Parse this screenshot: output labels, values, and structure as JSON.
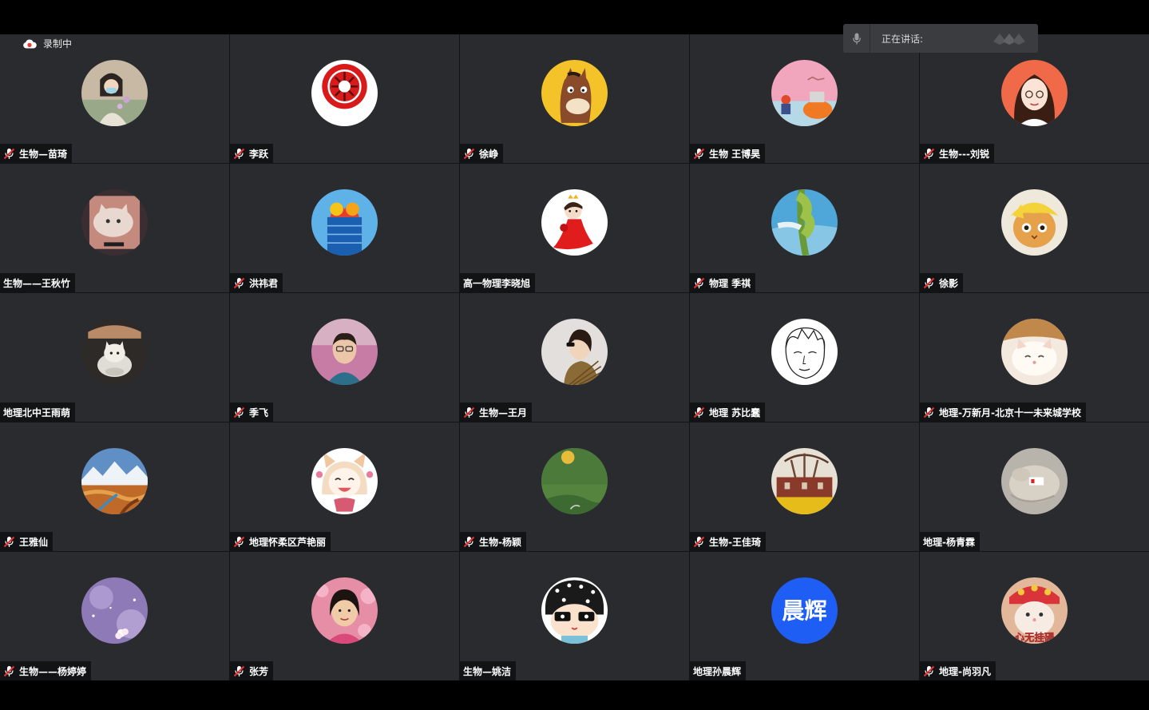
{
  "recording": {
    "label": "录制中",
    "icon": "cloud-record-icon",
    "color": "#e53935"
  },
  "speaking": {
    "label": "正在讲话:",
    "icon": "microphone-icon"
  },
  "participants": [
    {
      "name": "生物—苗琦",
      "muted": true,
      "avatar": "photo-girl-mask"
    },
    {
      "name": "李跃",
      "muted": true,
      "avatar": "red-emblem"
    },
    {
      "name": "徐峥",
      "muted": true,
      "avatar": "cartoon-horse"
    },
    {
      "name": "生物 王博昊",
      "muted": true,
      "avatar": "pink-landscape"
    },
    {
      "name": "生物---刘锐",
      "muted": true,
      "avatar": "illustrated-girl"
    },
    {
      "name": "生物——王秋竹",
      "muted": false,
      "avatar": "cat-photo"
    },
    {
      "name": "洪祎君",
      "muted": true,
      "avatar": "blue-building"
    },
    {
      "name": "高一物理李晓旭",
      "muted": false,
      "avatar": "cartoon-caped-boy"
    },
    {
      "name": "物理 季祺",
      "muted": true,
      "avatar": "green-plant"
    },
    {
      "name": "徐影",
      "muted": true,
      "avatar": "cat-in-hat"
    },
    {
      "name": "地理北中王雨萌",
      "muted": false,
      "avatar": "cat-in-cup"
    },
    {
      "name": "季飞",
      "muted": true,
      "avatar": "man-flowers"
    },
    {
      "name": "生物—王月",
      "muted": true,
      "avatar": "woman-sunglasses"
    },
    {
      "name": "地理 苏比蠢",
      "muted": true,
      "avatar": "sketch-face"
    },
    {
      "name": "地理-万新月-北京十一未来城学校",
      "muted": true,
      "avatar": "sleeping-cat"
    },
    {
      "name": "王雅仙",
      "muted": true,
      "avatar": "autumn-valley"
    },
    {
      "name": "地理怀柔区芦艳丽",
      "muted": true,
      "avatar": "anime-fox-girl"
    },
    {
      "name": "生物-杨颖",
      "muted": true,
      "avatar": "green-moon"
    },
    {
      "name": "生物-王佳琦",
      "muted": true,
      "avatar": "autumn-tree"
    },
    {
      "name": "地理-杨青霖",
      "muted": false,
      "avatar": "plush-toy"
    },
    {
      "name": "生物——杨婷婷",
      "muted": true,
      "avatar": "purple-blossom"
    },
    {
      "name": "张芳",
      "muted": true,
      "avatar": "woman-blossoms"
    },
    {
      "name": "生物—姚洁",
      "muted": false,
      "avatar": "cartoon-polka-girl"
    },
    {
      "name": "地理孙晨辉",
      "muted": false,
      "avatar": "initials",
      "initials": "晨辉",
      "initials_color": "#1e5ef5"
    },
    {
      "name": "地理-尚羽凡",
      "muted": true,
      "avatar": "cat-headdress",
      "caption": "心无挂碍"
    }
  ]
}
